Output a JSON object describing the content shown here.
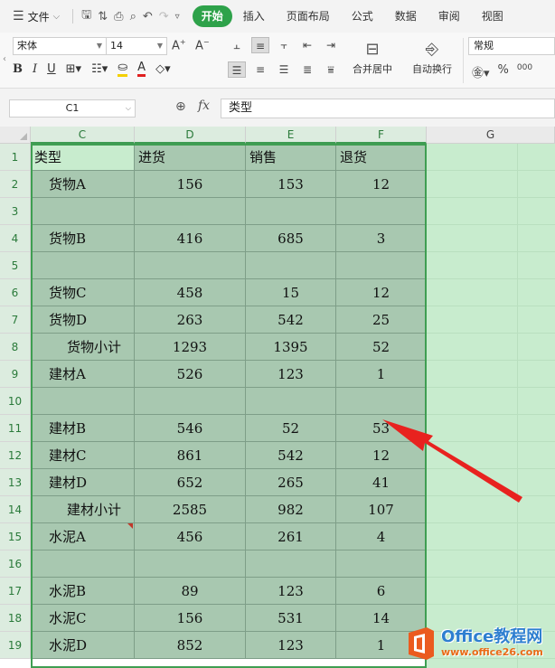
{
  "menubar": {
    "file_label": "文件",
    "tabs": [
      "开始",
      "插入",
      "页面布局",
      "公式",
      "数据",
      "审阅",
      "视图"
    ],
    "active_tab": 0
  },
  "ribbon": {
    "font_name": "宋体",
    "font_size": "14",
    "merge_center_label": "合并居中",
    "auto_wrap_label": "自动换行",
    "number_format": "常规"
  },
  "formula_bar": {
    "cell_ref": "C1",
    "fx_label": "fx",
    "content": "类型"
  },
  "sheet": {
    "columns": [
      "C",
      "D",
      "E",
      "F",
      "G"
    ],
    "selected_columns": [
      "C",
      "D",
      "E",
      "F"
    ],
    "rows": [
      {
        "n": "1",
        "cells": [
          "类型",
          "进货",
          "销售",
          "退货"
        ],
        "header": true
      },
      {
        "n": "2",
        "cells": [
          "货物A",
          "156",
          "153",
          "12"
        ]
      },
      {
        "n": "3",
        "cells": [
          "",
          "",
          "",
          ""
        ]
      },
      {
        "n": "4",
        "cells": [
          "货物B",
          "416",
          "685",
          "3"
        ]
      },
      {
        "n": "5",
        "cells": [
          "",
          "",
          "",
          ""
        ]
      },
      {
        "n": "6",
        "cells": [
          "货物C",
          "458",
          "15",
          "12"
        ]
      },
      {
        "n": "7",
        "cells": [
          "货物D",
          "263",
          "542",
          "25"
        ]
      },
      {
        "n": "8",
        "cells": [
          "货物小计",
          "1293",
          "1395",
          "52"
        ],
        "subtotal": true
      },
      {
        "n": "9",
        "cells": [
          "建材A",
          "526",
          "123",
          "1"
        ]
      },
      {
        "n": "10",
        "cells": [
          "",
          "",
          "",
          ""
        ]
      },
      {
        "n": "11",
        "cells": [
          "建材B",
          "546",
          "52",
          "53"
        ]
      },
      {
        "n": "12",
        "cells": [
          "建材C",
          "861",
          "542",
          "12"
        ]
      },
      {
        "n": "13",
        "cells": [
          "建材D",
          "652",
          "265",
          "41"
        ]
      },
      {
        "n": "14",
        "cells": [
          "建材小计",
          "2585",
          "982",
          "107"
        ],
        "subtotal": true
      },
      {
        "n": "15",
        "cells": [
          "水泥A",
          "456",
          "261",
          "4"
        ]
      },
      {
        "n": "16",
        "cells": [
          "",
          "",
          "",
          ""
        ]
      },
      {
        "n": "17",
        "cells": [
          "水泥B",
          "89",
          "123",
          "6"
        ]
      },
      {
        "n": "18",
        "cells": [
          "水泥C",
          "156",
          "531",
          "14"
        ]
      },
      {
        "n": "19",
        "cells": [
          "水泥D",
          "852",
          "123",
          "1"
        ]
      }
    ]
  },
  "colors": {
    "accent_green": "#2ea24a",
    "selection_fill": "#a8c8b0",
    "arrow_red": "#e8221f"
  },
  "watermark": {
    "title": "Office教程网",
    "url": "www.office26.com"
  }
}
